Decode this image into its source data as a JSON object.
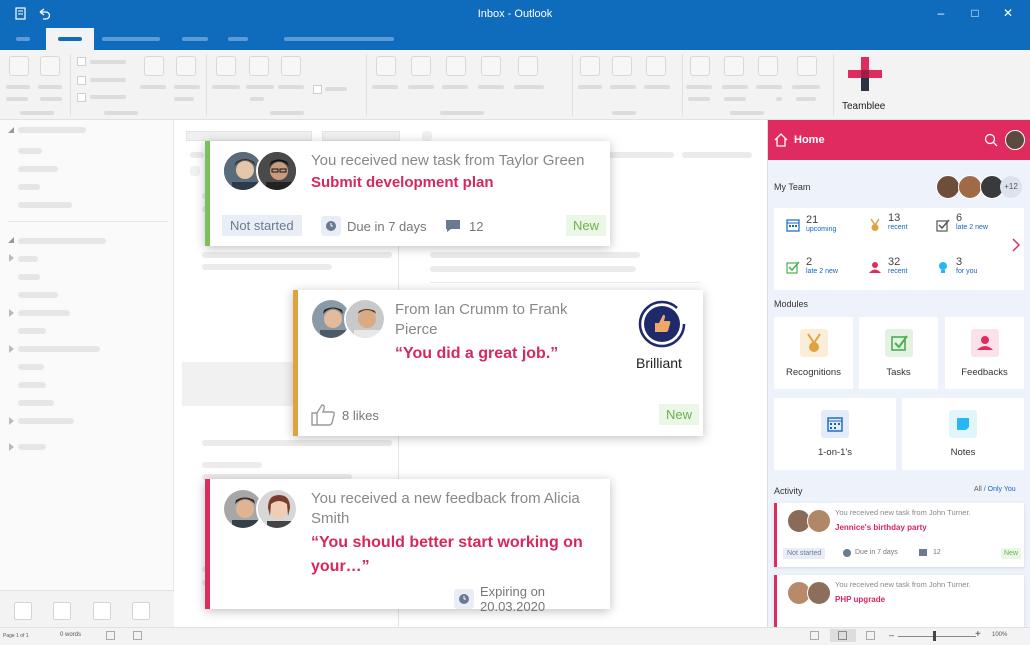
{
  "window": {
    "title": "Inbox - Outlook"
  },
  "brand": {
    "name": "Teamblee",
    "accent": "#e02b5e",
    "outlook_blue": "#0f6cbd"
  },
  "cards": [
    {
      "title": "You received new task from Taylor Green",
      "subtitle": "Submit development plan",
      "status": "Not started",
      "due": "Due in 7 days",
      "comments": "12",
      "badge": "New",
      "accent": "#7ac05c"
    },
    {
      "title": "From Ian Crumm to Frank Pierce",
      "quote": "“You did a great job.”",
      "award": "Brilliant",
      "likes": "8 likes",
      "badge": "New",
      "accent": "#e0a13f"
    },
    {
      "title": "You received a new feedback from Alicia Smith",
      "quote": "“You should better start working on your…”",
      "expiry": "Expiring on 20.03.2020",
      "accent": "#e02b5e"
    }
  ],
  "pane": {
    "home": "Home",
    "my_team": "My Team",
    "team_more": "+12",
    "stats": [
      {
        "n": "21",
        "l": "upcoming",
        "icon": "calendar-icon"
      },
      {
        "n": "13",
        "l": "recent",
        "icon": "medal-icon"
      },
      {
        "n": "6",
        "l": "late 2 new",
        "icon": "checkbox-icon"
      },
      {
        "n": "2",
        "l": "late 2 new",
        "icon": "task-check-icon"
      },
      {
        "n": "32",
        "l": "recent",
        "icon": "feedback-person-icon"
      },
      {
        "n": "3",
        "l": "for you",
        "icon": "lightbulb-icon"
      }
    ],
    "modules_label": "Modules",
    "modules": [
      "Recognitions",
      "Tasks",
      "Feedbacks",
      "1-on-1's",
      "Notes"
    ],
    "activity_label": "Activity",
    "activity_filter_all": "All",
    "activity_filter_sep": " / ",
    "activity_filter_mine": "Only You",
    "activity": [
      {
        "title": "You received new task from John Turner.",
        "subtitle": "Jennice's birthday party",
        "status": "Not started",
        "due": "Due in 7 days",
        "comments": "12",
        "badge": "New"
      },
      {
        "title": "You received new task from John Turner.",
        "subtitle": "PHP upgrade"
      }
    ]
  },
  "statusbar": {
    "page": "Page 1 of 1",
    "words": "0 words",
    "zoom": "100%"
  }
}
